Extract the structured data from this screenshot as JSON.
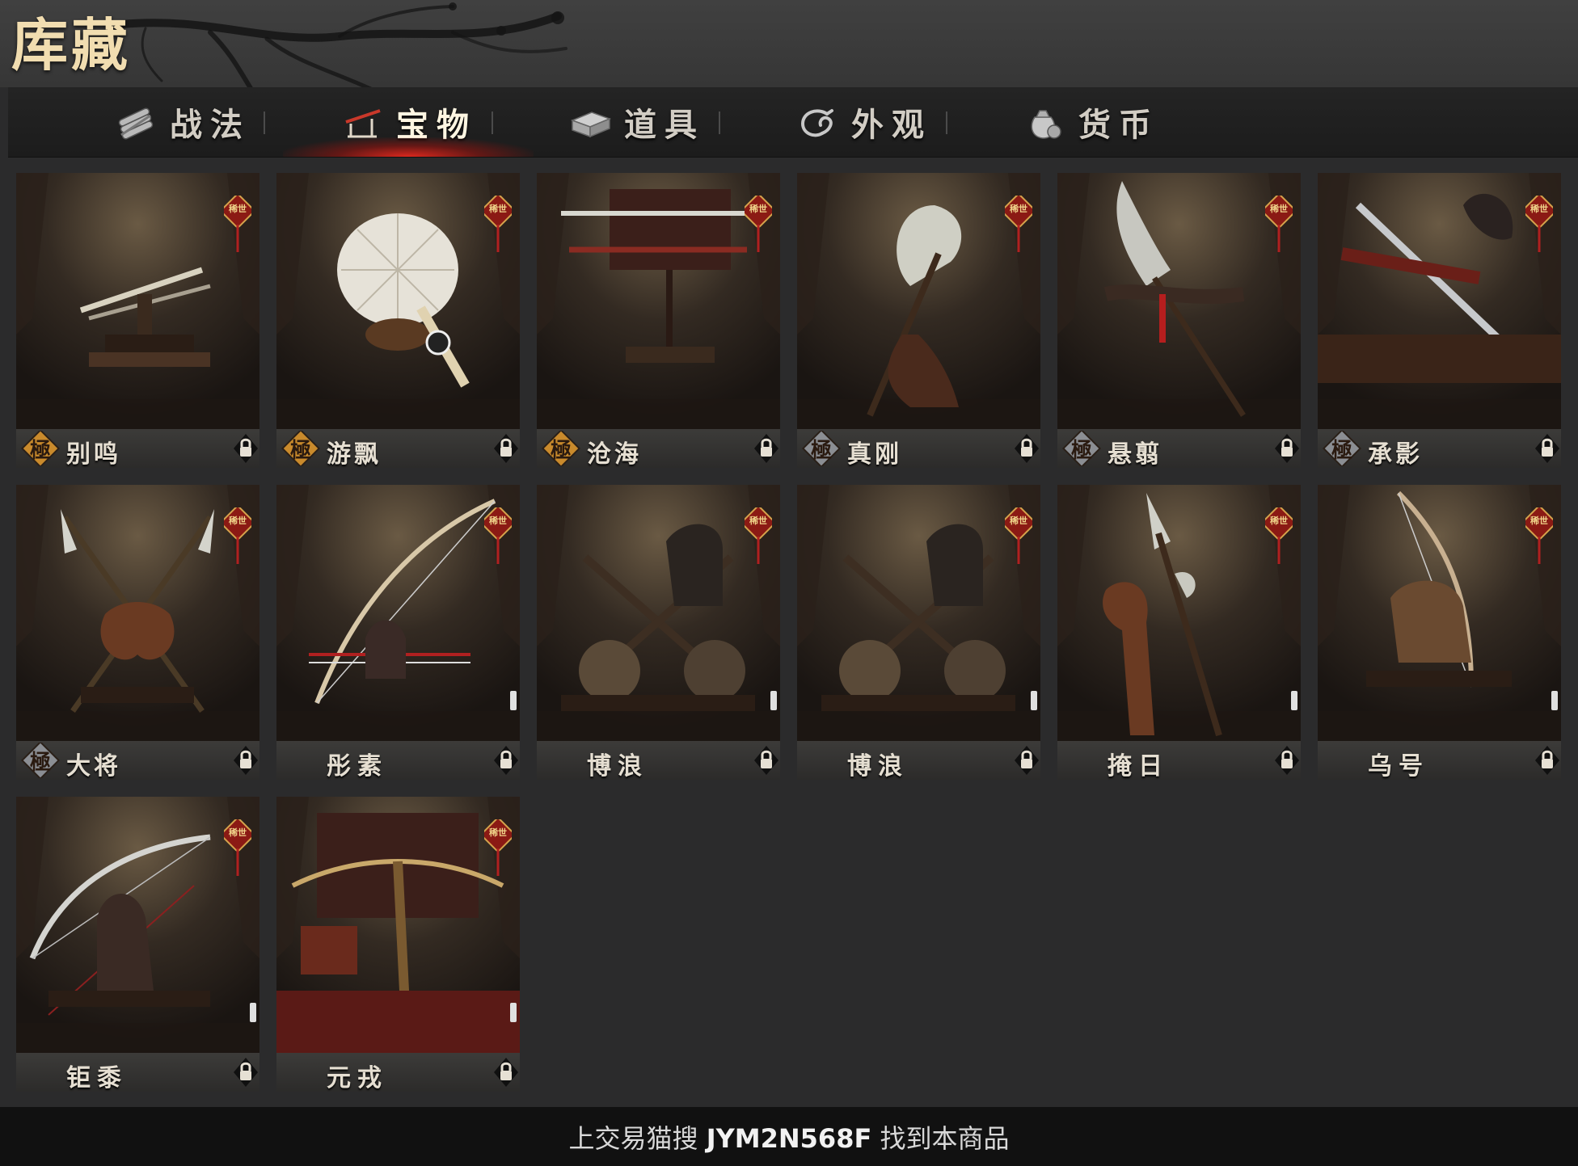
{
  "header": {
    "title": "库藏"
  },
  "tabs": [
    {
      "label": "战法",
      "icon": "scroll-bundle-icon",
      "active": false
    },
    {
      "label": "宝物",
      "icon": "weapon-rack-icon",
      "active": true
    },
    {
      "label": "道具",
      "icon": "chest-icon",
      "active": false
    },
    {
      "label": "外观",
      "icon": "swirl-icon",
      "active": false
    },
    {
      "label": "货币",
      "icon": "coin-pouch-icon",
      "active": false
    }
  ],
  "items": [
    {
      "name": "别鸣",
      "grade_badge": "極",
      "badge_style": "gold",
      "rare_tag": "稀世",
      "weapon": "twin-swords",
      "locked": true
    },
    {
      "name": "游飘",
      "grade_badge": "極",
      "badge_style": "gold",
      "rare_tag": "稀世",
      "weapon": "feather-fan",
      "locked": true
    },
    {
      "name": "沧海",
      "grade_badge": "極",
      "badge_style": "gold",
      "rare_tag": "稀世",
      "weapon": "sword-rack",
      "locked": true
    },
    {
      "name": "真刚",
      "grade_badge": "極",
      "badge_style": "silver",
      "rare_tag": "稀世",
      "weapon": "axe",
      "locked": true
    },
    {
      "name": "悬翦",
      "grade_badge": "極",
      "badge_style": "silver",
      "rare_tag": "稀世",
      "weapon": "glaive",
      "locked": true
    },
    {
      "name": "承影",
      "grade_badge": "極",
      "badge_style": "silver",
      "rare_tag": "稀世",
      "weapon": "long-sword",
      "locked": true
    },
    {
      "name": "大将",
      "grade_badge": "極",
      "badge_style": "silver",
      "rare_tag": "稀世",
      "weapon": "crossed-spears",
      "locked": true
    },
    {
      "name": "彤素",
      "grade_badge": "",
      "badge_style": "",
      "rare_tag": "稀世",
      "weapon": "red-bow",
      "locked": true
    },
    {
      "name": "博浪",
      "grade_badge": "",
      "badge_style": "",
      "rare_tag": "稀世",
      "weapon": "hammers",
      "locked": true
    },
    {
      "name": "博浪",
      "grade_badge": "",
      "badge_style": "",
      "rare_tag": "稀世",
      "weapon": "hammers",
      "locked": true
    },
    {
      "name": "掩日",
      "grade_badge": "",
      "badge_style": "",
      "rare_tag": "稀世",
      "weapon": "halberd",
      "locked": true
    },
    {
      "name": "乌号",
      "grade_badge": "",
      "badge_style": "",
      "rare_tag": "稀世",
      "weapon": "bow",
      "locked": true
    },
    {
      "name": "钜黍",
      "grade_badge": "",
      "badge_style": "",
      "rare_tag": "稀世",
      "weapon": "silver-bow",
      "locked": true
    },
    {
      "name": "元戎",
      "grade_badge": "",
      "badge_style": "",
      "rare_tag": "稀世",
      "weapon": "crossbow",
      "locked": true
    }
  ],
  "footer": {
    "prefix": "上交易猫搜",
    "code": "JYM2N568F",
    "suffix": "找到本商品"
  },
  "colors": {
    "accent_red": "#d42a1e",
    "gold_text": "#f1ddb0",
    "badge_gold": "#c98a2c",
    "badge_silver": "#8b8e93"
  }
}
